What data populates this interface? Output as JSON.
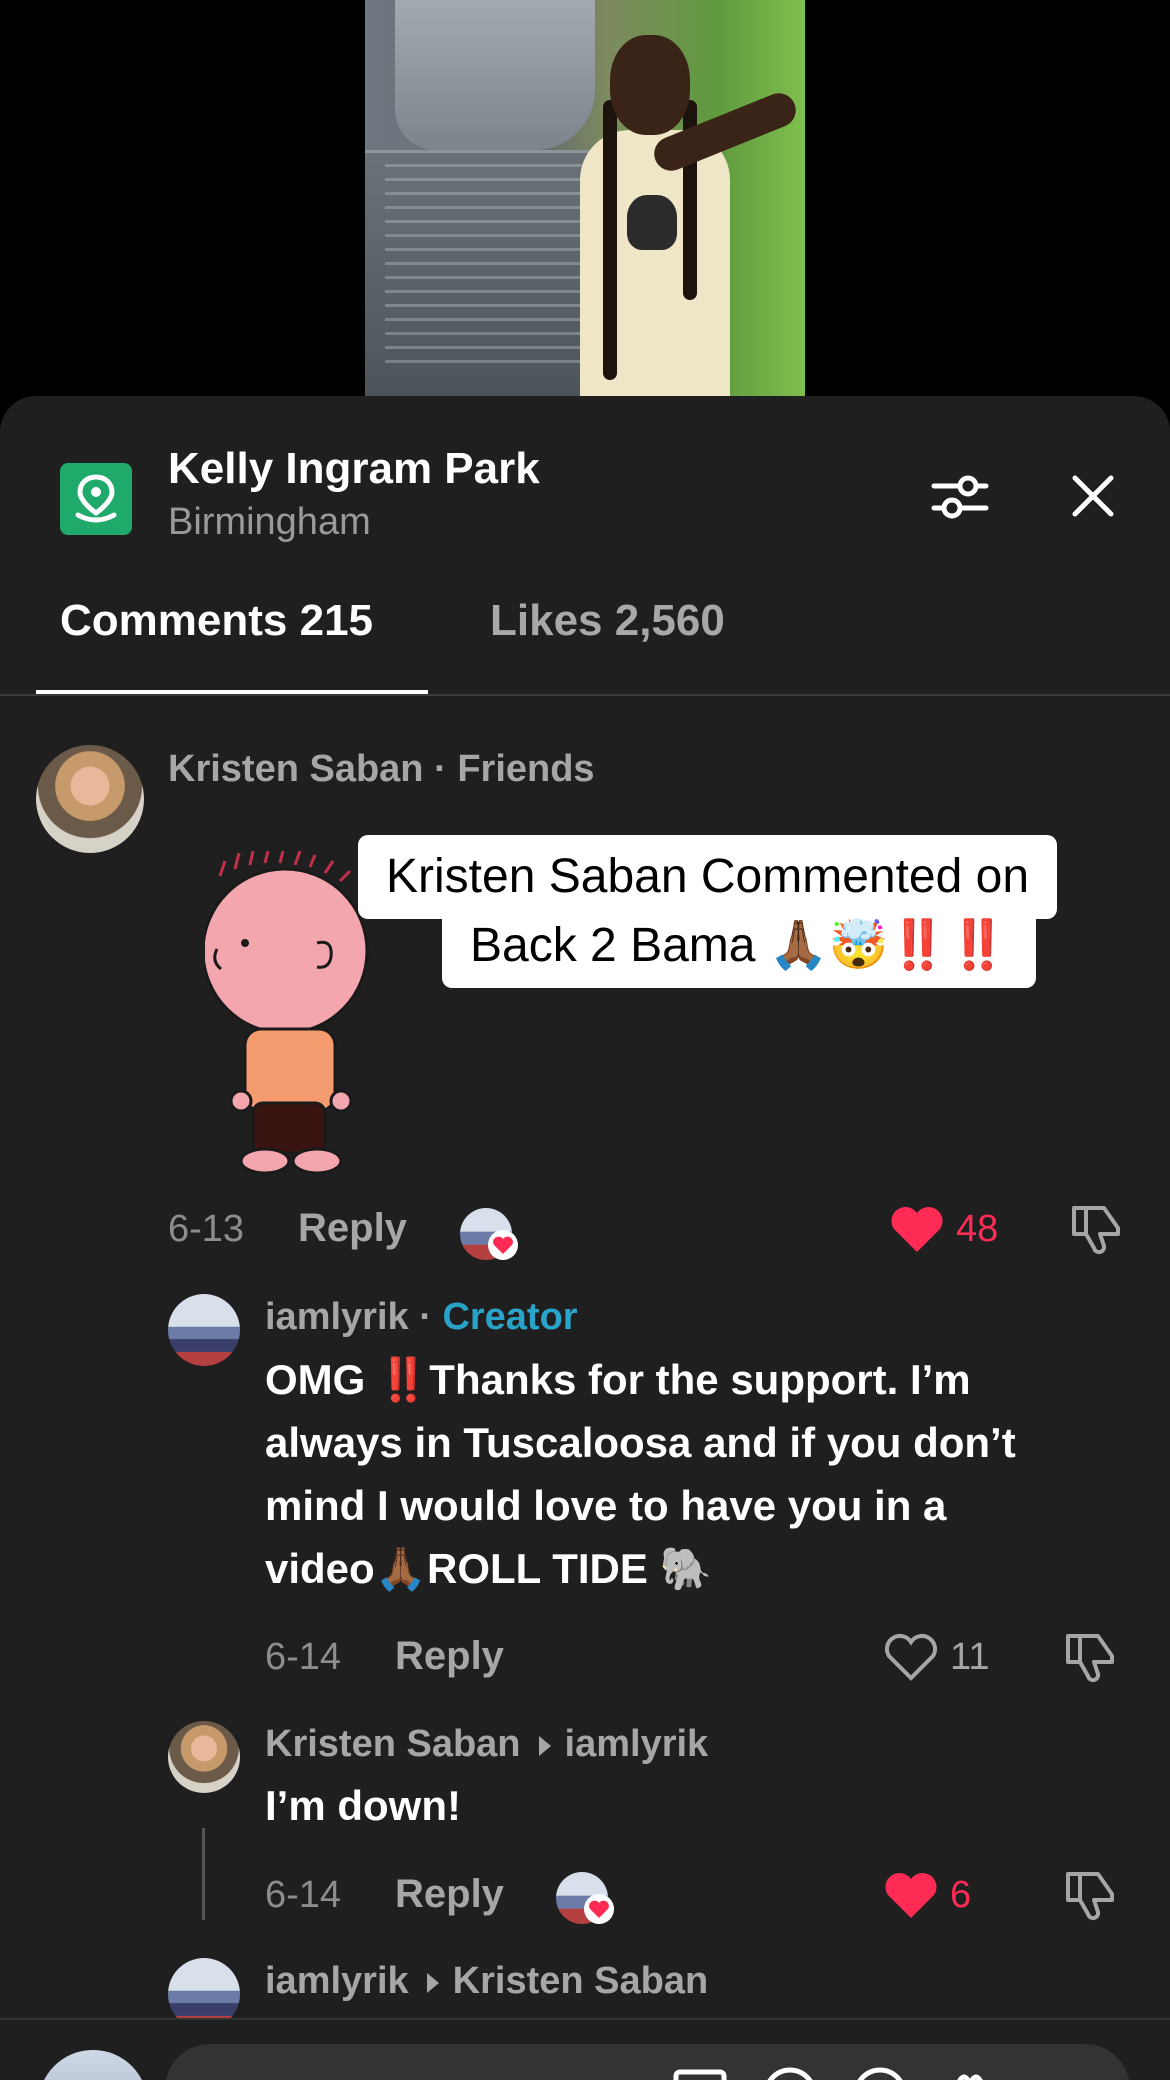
{
  "location": {
    "title": "Kelly Ingram Park",
    "subtitle": "Birmingham"
  },
  "tabs": {
    "comments": "Comments 215",
    "likes": "Likes 2,560"
  },
  "comments": [
    {
      "author": "Kristen Saban",
      "tag": "Friends",
      "caption_line1": "Kristen Saban Commented on",
      "caption_line2": "Back 2 Bama 🙏🏾🤯",
      "caption_bangs": "‼️‼️",
      "date": "6-13",
      "reply_label": "Reply",
      "likes": "48"
    },
    {
      "author": "iamlyrik",
      "tag": "Creator",
      "text_line1": "OMG ‼️Thanks for the support. I’m",
      "text_line2": "always in Tuscaloosa and if you don’t",
      "text_line3": "mind I would love to have you in a",
      "text_line4": "video🙏🏾ROLL TIDE 🐘",
      "date": "6-14",
      "reply_label": "Reply",
      "likes": "11"
    },
    {
      "author": "Kristen Saban",
      "reply_to": "iamlyrik",
      "text": "I’m down!",
      "date": "6-14",
      "reply_label": "Reply",
      "likes": "6"
    },
    {
      "author": "iamlyrik",
      "reply_to": "Kristen Saban"
    }
  ],
  "colors": {
    "like_red": "#fe2c55",
    "creator_blue": "#2aa3c9",
    "sheet_bg": "#1f1f1f"
  }
}
